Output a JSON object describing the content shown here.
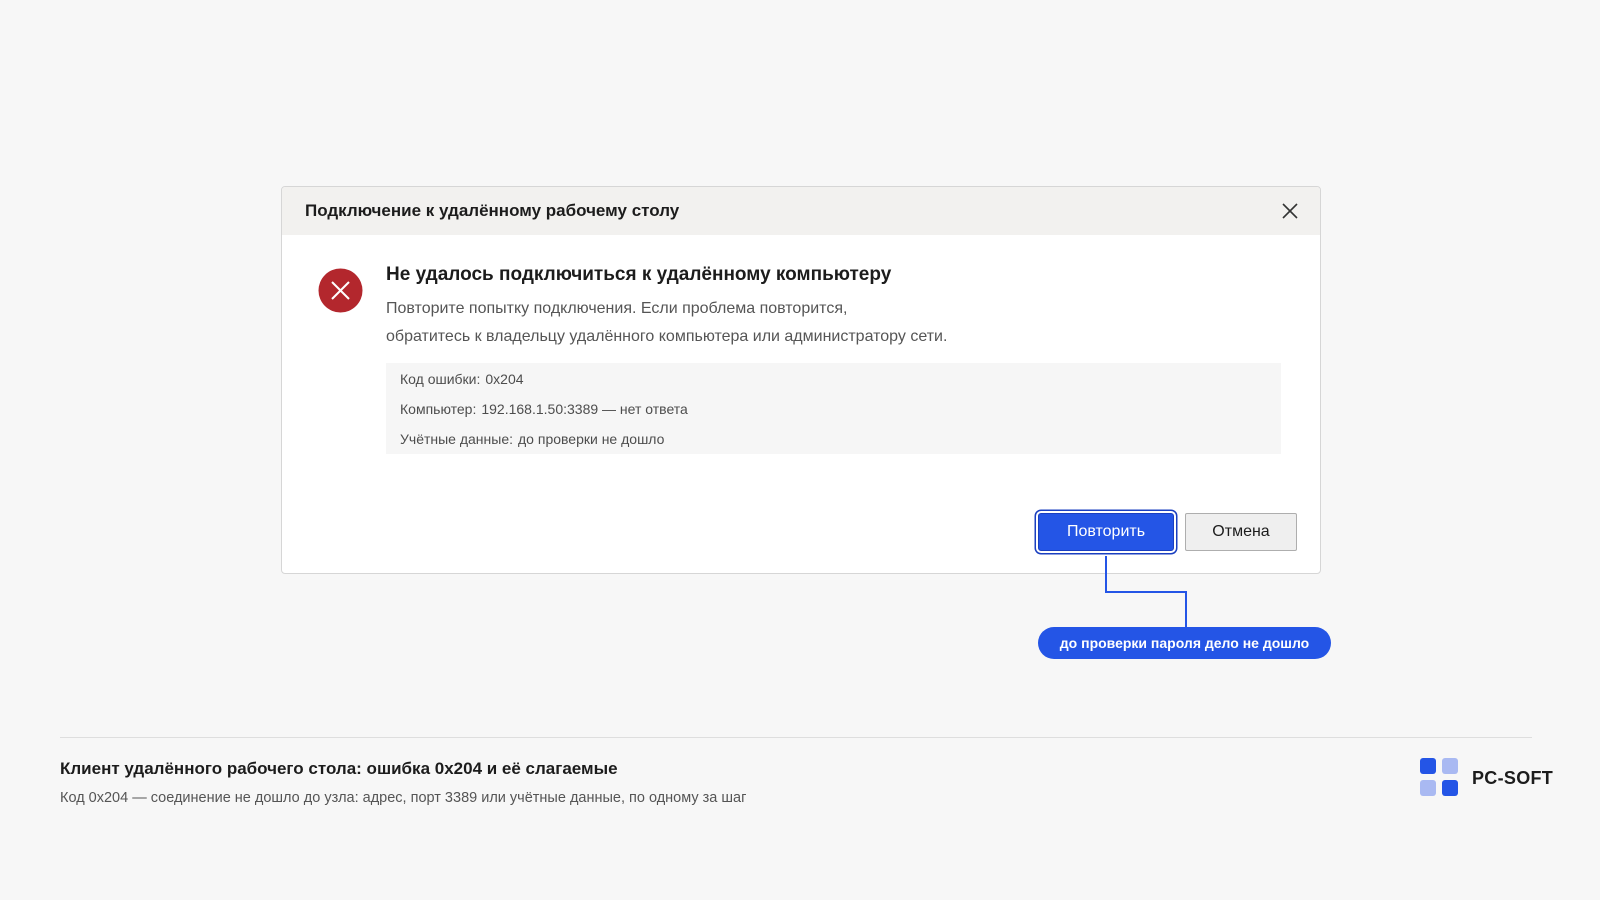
{
  "dialog": {
    "title": "Подключение к удалённому рабочему столу",
    "close_icon": "close-icon",
    "error_icon": "error-x-icon",
    "heading": "Не удалось подключиться к удалённому компьютеру",
    "desc_line1": "Повторите попытку подключения. Если проблема повторится,",
    "desc_line2": "обратитесь к владельцу удалённого компьютера или администратору сети.",
    "details": {
      "error_code": {
        "label": "Код ошибки:",
        "value": "0x204"
      },
      "computer": {
        "label": "Компьютер:",
        "value": "192.168.1.50:3389 — нет ответа"
      },
      "credentials": {
        "label": "Учётные данные:",
        "value": "до проверки не дошло"
      }
    },
    "retry_label": "Повторить",
    "cancel_label": "Отмена"
  },
  "callout": {
    "text": "до проверки пароля дело не дошло"
  },
  "footer": {
    "title": "Клиент удалённого рабочего стола: ошибка 0x204 и её слагаемые",
    "subtitle": "Код 0x204 — соединение не дошло до узла: адрес, порт 3389 или учётные данные, по одному за шаг",
    "brand": "PC-SOFT"
  },
  "colors": {
    "accent": "#2455e6",
    "error": "#b3272d",
    "logo_dark": "#2455e6",
    "logo_light": "#a9b9f2"
  }
}
